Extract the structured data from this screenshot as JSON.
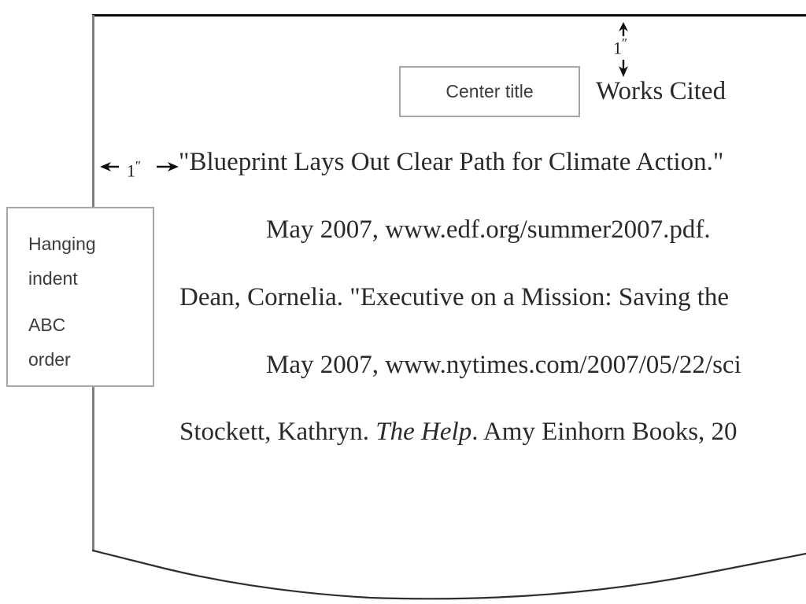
{
  "page": {
    "sheet_outline_color": "#808080",
    "sheet_top_edge_color": "#0d0d0d",
    "background_color": "#ffffff",
    "text_color": "#2a2a2a"
  },
  "document": {
    "title": "Works Cited",
    "entries": [
      {
        "id": "entry-blueprint",
        "line1_prefix": "\"Blueprint Lays Out Clear Path for Climate Action.\"",
        "line2": "May 2007, www.edf.org/summer2007.pdf."
      },
      {
        "id": "entry-dean",
        "line1_prefix": "Dean, Cornelia. \"Executive on a Mission: Saving the",
        "line2": "May 2007, www.nytimes.com/2007/05/22/sci"
      },
      {
        "id": "entry-stockett",
        "line1_before_italic": "Stockett, Kathryn. ",
        "line1_italic": "The Help",
        "line1_after_italic": ". Amy Einhorn Books, 20"
      }
    ]
  },
  "callouts": {
    "center_title": {
      "label": "Center title"
    },
    "hanging_indent": {
      "line1": "Hanging",
      "line2": "indent",
      "line3": "ABC",
      "line4": "order"
    }
  },
  "annotations": {
    "top_margin": {
      "value": "1",
      "unit": "″",
      "description": "vertical-double-arrow-one-inch"
    },
    "left_margin": {
      "value": "1",
      "unit": "″",
      "description": "horizontal-double-arrow-one-inch"
    }
  }
}
